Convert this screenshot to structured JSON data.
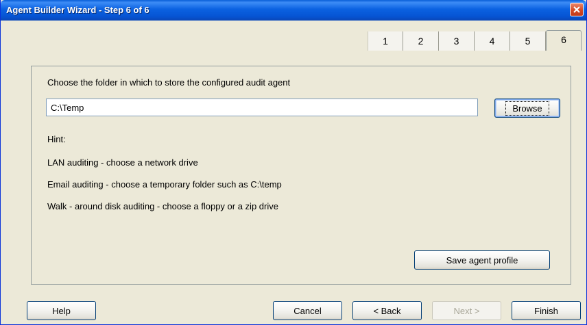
{
  "window": {
    "title": "Agent Builder Wizard - Step 6 of 6"
  },
  "tabs": [
    {
      "label": "1",
      "active": false
    },
    {
      "label": "2",
      "active": false
    },
    {
      "label": "3",
      "active": false
    },
    {
      "label": "4",
      "active": false
    },
    {
      "label": "5",
      "active": false
    },
    {
      "label": "6",
      "active": true
    }
  ],
  "main": {
    "prompt": "Choose the folder in which to store the configured audit agent",
    "folder_value": "C:\\Temp",
    "browse_label": "Browse",
    "hint_title": "Hint:",
    "hints": [
      "LAN auditing - choose a network drive",
      "Email auditing - choose a temporary folder such as C:\\temp",
      "Walk - around disk auditing - choose a floppy or a zip drive"
    ],
    "save_profile_label": "Save agent profile"
  },
  "footer": {
    "help_label": "Help",
    "cancel_label": "Cancel",
    "back_label": "< Back",
    "next_label": "Next >",
    "finish_label": "Finish"
  },
  "icons": {
    "close": "close-icon"
  },
  "colors": {
    "titlebar": "#0b62e1",
    "close_button": "#d44a25",
    "window_background": "#ece9d8",
    "disabled_text": "#a8a698"
  }
}
